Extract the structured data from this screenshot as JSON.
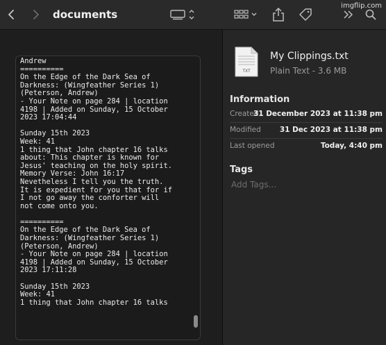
{
  "toolbar": {
    "title": "documents",
    "watermark": "imgflip.com",
    "icons": [
      "chevron-left-icon",
      "chevron-right-icon",
      "view-mode-icon",
      "group-icon",
      "share-icon",
      "tag-icon",
      "more-icon",
      "search-icon"
    ]
  },
  "preview": {
    "text": "Andrew\n==========\nOn the Edge of the Dark Sea of\nDarkness: (Wingfeather Series 1)\n(Peterson, Andrew)\n- Your Note on page 284 | location\n4198 | Added on Sunday, 15 October\n2023 17:04:44\n\nSunday 15th 2023\nWeek: 41\n1 thing that John chapter 16 talks\nabout: This chapter is known for\nJesus' teaching on the holy spirit.\nMemory Verse: John 16:17\nNevetheless I tell you the truth.\nIt is expedient for you that for if\nI not go away the conforter will\nnot come onto you.\n\n==========\nOn the Edge of the Dark Sea of\nDarkness: (Wingfeather Series 1)\n(Peterson, Andrew)\n- Your Note on page 284 | location\n4198 | Added on Sunday, 15 October\n2023 17:11:28\n\nSunday 15th 2023\nWeek: 41\n1 thing that John chapter 16 talks"
  },
  "file": {
    "icon_label": "TXT",
    "name": "My Clippings.txt",
    "meta": "Plain Text - 3.6 MB"
  },
  "information": {
    "title": "Information",
    "rows": [
      {
        "label": "Created",
        "value": "31 December 2023 at 11:38 pm"
      },
      {
        "label": "Modified",
        "value": "31 Dec 2023 at 11:38 pm"
      },
      {
        "label": "Last opened",
        "value": "Today, 4:40 pm"
      }
    ]
  },
  "tags": {
    "title": "Tags",
    "placeholder": "Add Tags..."
  }
}
